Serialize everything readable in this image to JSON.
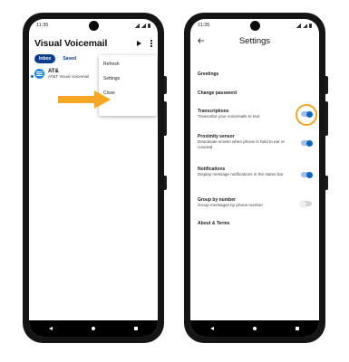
{
  "colors": {
    "accent_blue": "#0a3d91",
    "toggle_on": "#1565c0",
    "highlight_orange": "#f5a623"
  },
  "left_screen": {
    "status_time": "11:35",
    "title": "Visual Voicemail",
    "tabs": [
      {
        "label": "Inbox",
        "active": true
      },
      {
        "label": "Saved",
        "active": false
      }
    ],
    "voicemail": {
      "name": "AT&",
      "subtitle": "AT&T Visual Voicemail"
    },
    "menu_items": [
      {
        "label": "Refresh"
      },
      {
        "label": "Settings"
      },
      {
        "label": "Close"
      }
    ]
  },
  "right_screen": {
    "status_time": "11:35",
    "title": "Settings",
    "items": [
      {
        "title": "Greetings"
      },
      {
        "title": "Change password"
      },
      {
        "title": "Transcriptions",
        "desc": "Transcribe your voicemails to text",
        "toggle": true,
        "highlighted": true
      },
      {
        "title": "Proximity sensor",
        "desc": "Deactivate screen when phone is held to ear or covered",
        "toggle": true
      },
      {
        "title": "Notifications",
        "desc": "Display message notifications in the status bar",
        "toggle": true
      },
      {
        "title": "Group by number",
        "desc": "Group messages by phone number",
        "toggle": false
      },
      {
        "title": "About & Terms"
      }
    ]
  }
}
